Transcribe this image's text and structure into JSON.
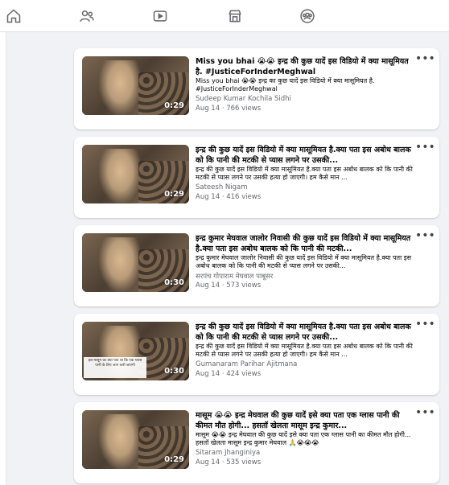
{
  "nav": {
    "tabs": [
      {
        "name": "home-tab",
        "icon": "home-icon"
      },
      {
        "name": "friends-tab",
        "icon": "friends-icon"
      },
      {
        "name": "watch-tab",
        "icon": "video-icon"
      },
      {
        "name": "marketplace-tab",
        "icon": "marketplace-icon"
      },
      {
        "name": "groups-tab",
        "icon": "groups-icon"
      }
    ],
    "icon_color": "#65676b"
  },
  "videos": [
    {
      "title": "Miss you bhai 😭😭 इन्द्र की कुछ यादें इस विडियो में क्या मासूमियत है. #JusticeForInderMeghwal",
      "desc": "Miss you bhai 😭😭 इन्द्र का कुछ यादें इस विडियो में क्या मासूमियत है. #JusticeForInderMeghwal",
      "author": "Sudeep Kumar Kochila Sidhi",
      "meta": "Aug 14 · 766 views",
      "duration": "0:29",
      "thumb_caption": ""
    },
    {
      "title": "इन्द्र की कुछ यादें इस विडियो में क्या मासूमियत है.क्या पता इस अबोध बालक को कि पानी की मटकी से प्यास लगने पर उसकी...",
      "desc": "इन्द्र की कुछ यादें इस विडियो में क्या मासूमियत है.क्या पता इस अबोध बालक को कि पानी की मटकी से प्यास लगने पर उसकी हत्या हो जाएगी। हम कैसे मान ...",
      "author": "Sateesh Nigam",
      "meta": "Aug 14 · 416 views",
      "duration": "0:29",
      "thumb_caption": ""
    },
    {
      "title": "इन्द्र कुमार मेघवाल जालोर निवासी की कुछ यादें इस विडियो में क्या मासूमियत है.क्या पता इस अबोध बालक को कि पानी की मटकी...",
      "desc": "इन्द्र कुमार मेघवाल जालोर निवासी की कुछ यादें इस विडियो में क्या मासूमियत है.क्या पता इस अबोध बालक को कि पानी की मटकी से प्यास लगने पर उसकी...",
      "author": "सरपंच गोपाराम मेघवाल पाबूसर",
      "meta": "Aug 14 · 573 views",
      "duration": "0:30",
      "thumb_caption": ""
    },
    {
      "title": "इन्द्र की कुछ यादें इस विडियो में क्या मासूमियत है.क्या पता इस अबोध बालक को कि पानी की मटकी से प्यास लगने पर उसकी...",
      "desc": "इन्द्र की कुछ यादें इस विडियो में क्या मासूमियत है.क्या पता इस अबोध बालक को कि पानी की मटकी से प्यास लगने पर उसकी हत्या हो जाएगी। हम कैसे मान ...",
      "author": "Gumanaram Parihar Ajitmana",
      "meta": "Aug 14 · 424 views",
      "duration": "0:30",
      "thumb_caption": "इस मासूम का क्या पता था कि एक ग्लास पानी के लिए जान चली जाएगी"
    },
    {
      "title": "मासूम 😭😭 इन्द्र मेघवाल की कुछ यादें इसे क्या पता एक ग्लास पानी की कीमत मौत होगी... हसतॉ खेलता मासूम इन्द्र कुमार...",
      "desc": "मासूम 😭😭 इन्द्र मेघवाल की कुछ यादें इसे क्या पता एक ग्लास पानी का कीमत मौत होगी... हसतॉ खेलता मासूम इन्द्र कुमार मेघवाल 🙏😭😭😭",
      "author": "Sitaram Jhanginiya",
      "meta": "Aug 14 · 535 views",
      "duration": "0:29",
      "thumb_caption": ""
    }
  ],
  "more_label": "•••"
}
